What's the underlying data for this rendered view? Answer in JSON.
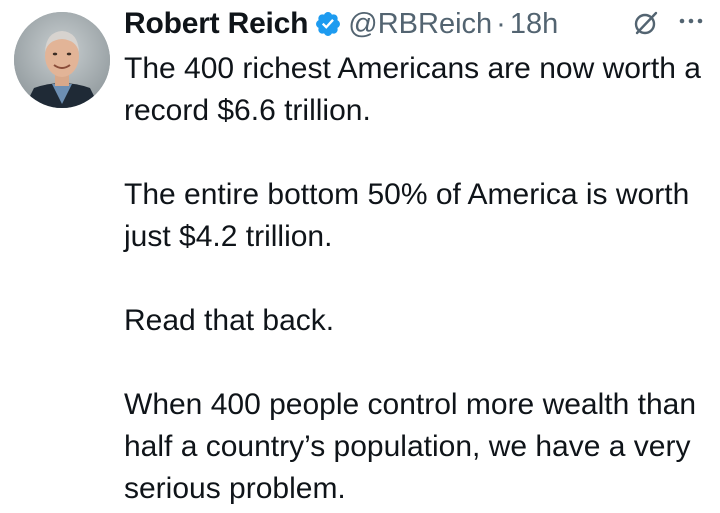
{
  "tweet": {
    "author_name": "Robert Reich",
    "handle": "@RBReich",
    "separator": "·",
    "time": "18h",
    "paragraphs": [
      "The 400 richest Americans are now worth a record $6.6 trillion.",
      "The entire bottom 50% of America is worth just $4.2 trillion.",
      "Read that back.",
      "When 400 people control more wealth than half a country’s population, we have a very serious problem."
    ]
  },
  "icons": {
    "verified": "verified-badge-icon",
    "grok": "grok-icon",
    "more": "more-options-icon"
  },
  "colors": {
    "text": "#0f1419",
    "secondary": "#536471",
    "verified_blue": "#1d9bf0"
  }
}
